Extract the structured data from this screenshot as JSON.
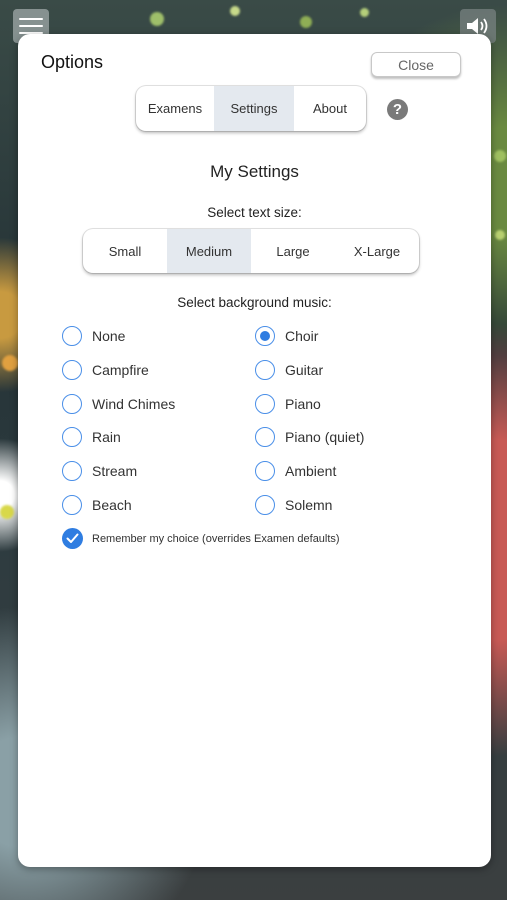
{
  "header": {
    "menu_icon": "hamburger-menu-icon",
    "sound_icon": "speaker-icon"
  },
  "dialog": {
    "title": "Options",
    "close_label": "Close",
    "tabs": [
      {
        "label": "Examens",
        "active": false
      },
      {
        "label": "Settings",
        "active": true
      },
      {
        "label": "About",
        "active": false
      }
    ],
    "help_glyph": "?"
  },
  "settings": {
    "heading": "My Settings",
    "text_size_label": "Select text size:",
    "text_sizes": [
      {
        "label": "Small",
        "active": false
      },
      {
        "label": "Medium",
        "active": true
      },
      {
        "label": "Large",
        "active": false
      },
      {
        "label": "X-Large",
        "active": false
      }
    ],
    "music_label": "Select background music:",
    "music_left": [
      {
        "label": "None",
        "checked": false
      },
      {
        "label": "Campfire",
        "checked": false
      },
      {
        "label": "Wind Chimes",
        "checked": false
      },
      {
        "label": "Rain",
        "checked": false
      },
      {
        "label": "Stream",
        "checked": false
      },
      {
        "label": "Beach",
        "checked": false
      }
    ],
    "music_right": [
      {
        "label": "Choir",
        "checked": true
      },
      {
        "label": "Guitar",
        "checked": false
      },
      {
        "label": "Piano",
        "checked": false
      },
      {
        "label": "Piano (quiet)",
        "checked": false
      },
      {
        "label": "Ambient",
        "checked": false
      },
      {
        "label": "Solemn",
        "checked": false
      }
    ],
    "remember_label": "Remember my choice (overrides Examen defaults)",
    "remember_checked": true
  },
  "colors": {
    "accent": "#2f7de1",
    "active_segment": "#e4e9ef"
  }
}
